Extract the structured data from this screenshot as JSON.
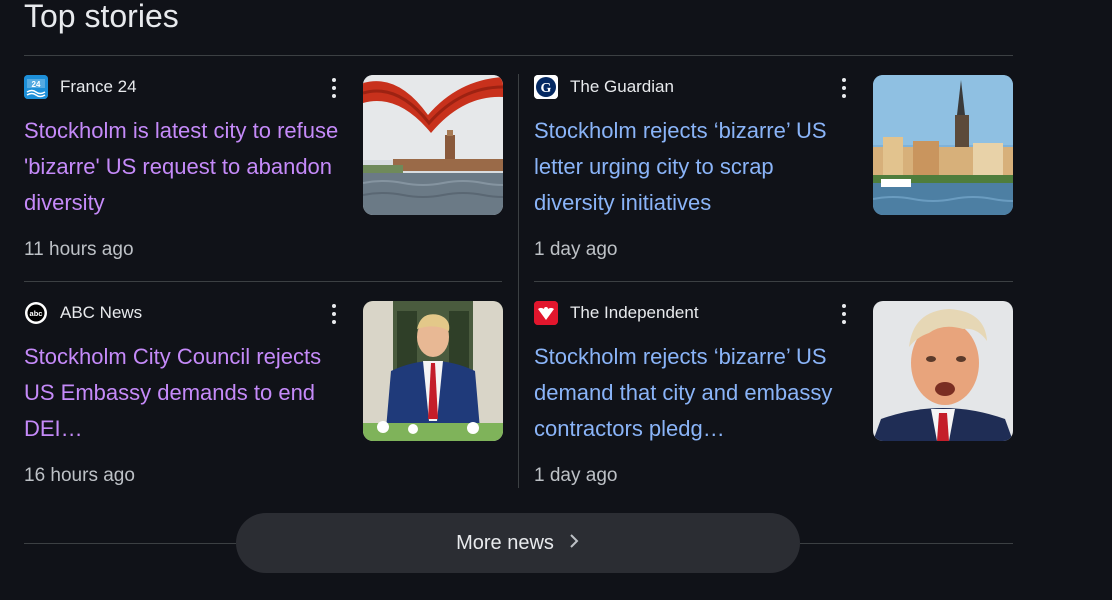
{
  "section": {
    "title": "Top stories"
  },
  "stories": [
    {
      "source": "France 24",
      "logo_icon": "france24-logo-icon",
      "headline": "Stockholm is latest city to refuse 'bizarre' US request to abandon diversity",
      "time": "11 hours ago",
      "headline_color": "#c58af9",
      "thumb": "stockholm-city-hall-photo"
    },
    {
      "source": "The Guardian",
      "logo_icon": "guardian-logo-icon",
      "headline": "Stockholm rejects ‘bizarre’ US letter urging city to scrap diversity initiatives",
      "time": "1 day ago",
      "headline_color": "#8ab4f8",
      "thumb": "stockholm-gamla-stan-photo"
    },
    {
      "source": "ABC News",
      "logo_icon": "abc-logo-icon",
      "headline": "Stockholm City Council rejects US Embassy demands to end DEI…",
      "time": "16 hours ago",
      "headline_color": "#c58af9",
      "thumb": "man-in-suit-garden-photo"
    },
    {
      "source": "The Independent",
      "logo_icon": "independent-logo-icon",
      "headline": "Stockholm rejects ‘bizarre’ US demand that city and embassy contractors pledg…",
      "time": "1 day ago",
      "headline_color": "#8ab4f8",
      "thumb": "man-portrait-photo"
    }
  ],
  "more_news": {
    "label": "More news",
    "icon": "chevron-right-icon"
  }
}
